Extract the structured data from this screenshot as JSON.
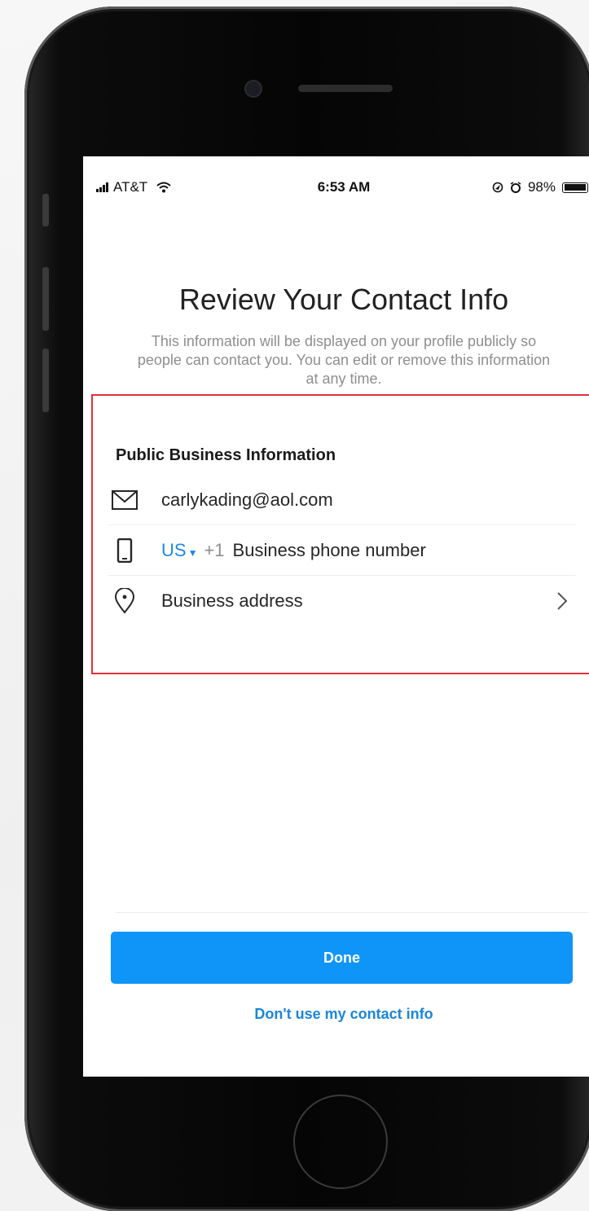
{
  "status_bar": {
    "carrier": "AT&T",
    "time": "6:53 AM",
    "battery": "98%",
    "battery_level": 0.98,
    "icons": [
      "signal-icon",
      "wifi-icon",
      "location-icon",
      "alarm-icon",
      "battery-icon"
    ]
  },
  "header": {
    "title": "Review Your Contact Info",
    "subtitle": "This information will be displayed on your profile publicly so people can contact you. You can edit or remove this information at any time."
  },
  "section": {
    "title": "Public Business Information",
    "email": "carlykading@aol.com",
    "country_code": "US",
    "dial_prefix": "+1",
    "phone_placeholder": "Business phone number",
    "address_label": "Business address"
  },
  "actions": {
    "done_label": "Done",
    "skip_label": "Don't use my contact info"
  },
  "colors": {
    "accent": "#0f95f7",
    "link": "#1a86d8",
    "highlight_border": "#e0303a"
  }
}
